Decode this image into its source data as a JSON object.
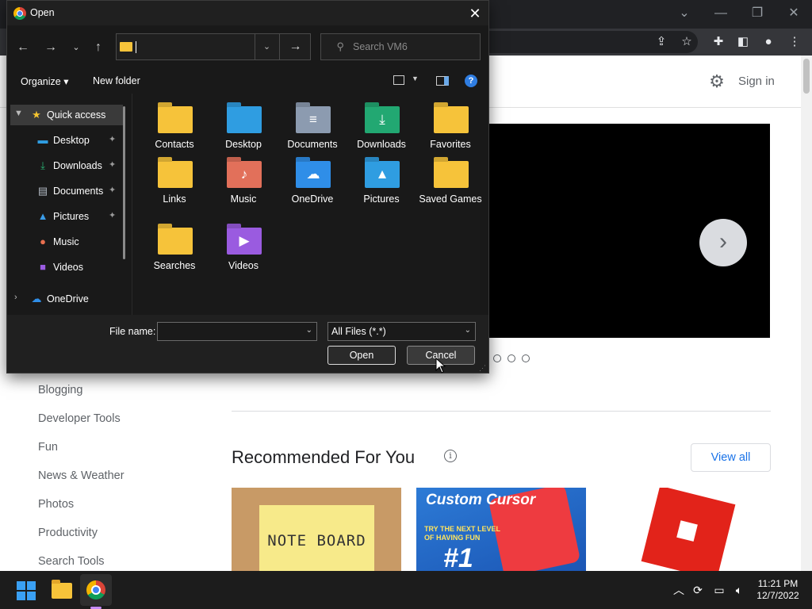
{
  "colors": {
    "dialog_bg": "#191919",
    "chrome_dark": "#202124",
    "folder_yellow": "#f6c33a",
    "accent_blue": "#1a73e8",
    "roblox_red": "#e2231a"
  },
  "browser": {
    "window_controls": {
      "minimize": "—",
      "restore": "❐",
      "close": "✕",
      "tabs_menu": "⌄"
    },
    "toolbar_icons": [
      "share-icon",
      "star-icon",
      "puzzle-icon",
      "side-panel-icon",
      "profile-icon",
      "menu-icon"
    ],
    "page": {
      "sign_in": "Sign in",
      "sidebar_links": [
        "Blogging",
        "Developer Tools",
        "Fun",
        "News & Weather",
        "Photos",
        "Productivity",
        "Search Tools"
      ],
      "recommended_title": "Recommended For You",
      "view_all": "View all",
      "cards": [
        {
          "label": "NOTE BOARD"
        },
        {
          "title": "Custom Cursor",
          "sub_line1": "TRY THE NEXT LEVEL",
          "sub_line2": "OF HAVING FUN",
          "number": "#1"
        },
        {
          "label": ""
        }
      ]
    }
  },
  "dialog": {
    "title": "Open",
    "search_placeholder": "Search VM6",
    "organize": "Organize ▾",
    "new_folder": "New folder",
    "nav_items": [
      {
        "label": "Quick access",
        "icon": "star-icon",
        "pinned": false,
        "selected": true
      },
      {
        "label": "Desktop",
        "icon": "desktop-icon",
        "pinned": true
      },
      {
        "label": "Downloads",
        "icon": "downloads-icon",
        "pinned": true
      },
      {
        "label": "Documents",
        "icon": "documents-icon",
        "pinned": true
      },
      {
        "label": "Pictures",
        "icon": "pictures-icon",
        "pinned": true
      },
      {
        "label": "Music",
        "icon": "music-icon",
        "pinned": false
      },
      {
        "label": "Videos",
        "icon": "videos-icon",
        "pinned": false
      },
      {
        "label": "OneDrive",
        "icon": "onedrive-icon",
        "pinned": false
      }
    ],
    "folders": [
      {
        "label": "Contacts",
        "icon": "contacts-folder-icon"
      },
      {
        "label": "Desktop",
        "icon": "desktop-folder-icon"
      },
      {
        "label": "Documents",
        "icon": "documents-folder-icon"
      },
      {
        "label": "Downloads",
        "icon": "downloads-folder-icon"
      },
      {
        "label": "Favorites",
        "icon": "favorites-folder-icon"
      },
      {
        "label": "Links",
        "icon": "links-folder-icon"
      },
      {
        "label": "Music",
        "icon": "music-folder-icon"
      },
      {
        "label": "OneDrive",
        "icon": "onedrive-folder-icon"
      },
      {
        "label": "Pictures",
        "icon": "pictures-folder-icon"
      },
      {
        "label": "Saved Games",
        "icon": "saved-games-folder-icon"
      },
      {
        "label": "Searches",
        "icon": "searches-folder-icon"
      },
      {
        "label": "Videos",
        "icon": "videos-folder-icon"
      }
    ],
    "file_name_label": "File name:",
    "file_name_value": "",
    "file_type": "All Files (*.*)",
    "open_button": "Open",
    "cancel_button": "Cancel"
  },
  "taskbar": {
    "time": "11:21 PM",
    "date": "12/7/2022",
    "apps": [
      "start-icon",
      "file-explorer-icon",
      "chrome-icon"
    ],
    "tray": [
      "show-hidden-icons",
      "sync-icon",
      "network-icon",
      "volume-icon"
    ]
  }
}
